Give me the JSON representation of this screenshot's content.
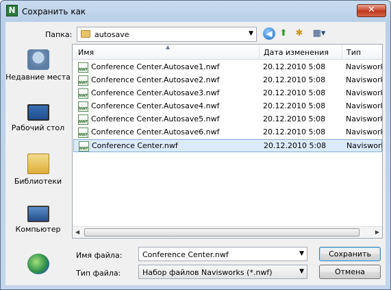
{
  "window": {
    "title": "Сохранить как",
    "app_icon_letter": "N",
    "close_glyph": "✕"
  },
  "toolbar": {
    "folder_label": "Папка:",
    "folder_value": "autosave"
  },
  "places": [
    {
      "label": "Недавние места",
      "icon": "recent-places-icon"
    },
    {
      "label": "Рабочий стол",
      "icon": "desktop-icon"
    },
    {
      "label": "Библиотеки",
      "icon": "libraries-icon"
    },
    {
      "label": "Компьютер",
      "icon": "computer-icon"
    },
    {
      "label": "",
      "icon": "network-icon"
    }
  ],
  "columns": {
    "name": "Имя",
    "date": "Дата изменения",
    "type": "Тип"
  },
  "files": [
    {
      "name": "Conference Center.Autosave1.nwf",
      "date": "20.12.2010 5:08",
      "type": "Navisworks"
    },
    {
      "name": "Conference Center.Autosave2.nwf",
      "date": "20.12.2010 5:08",
      "type": "Navisworks"
    },
    {
      "name": "Conference Center.Autosave3.nwf",
      "date": "20.12.2010 5:08",
      "type": "Navisworks"
    },
    {
      "name": "Conference Center.Autosave4.nwf",
      "date": "20.12.2010 5:08",
      "type": "Navisworks"
    },
    {
      "name": "Conference Center.Autosave5.nwf",
      "date": "20.12.2010 5:08",
      "type": "Navisworks"
    },
    {
      "name": "Conference Center.Autosave6.nwf",
      "date": "20.12.2010 5:08",
      "type": "Navisworks"
    },
    {
      "name": "Conference Center.nwf",
      "date": "20.12.2010 5:08",
      "type": "Navisworks"
    }
  ],
  "file_icon_text": "NWF",
  "footer": {
    "filename_label": "Имя файла:",
    "filename_value": "Conference Center.nwf",
    "filetype_label": "Тип файла:",
    "filetype_value": "Набор файлов Navisworks (*.nwf)",
    "save_label": "Сохранить",
    "cancel_label": "Отмена"
  }
}
